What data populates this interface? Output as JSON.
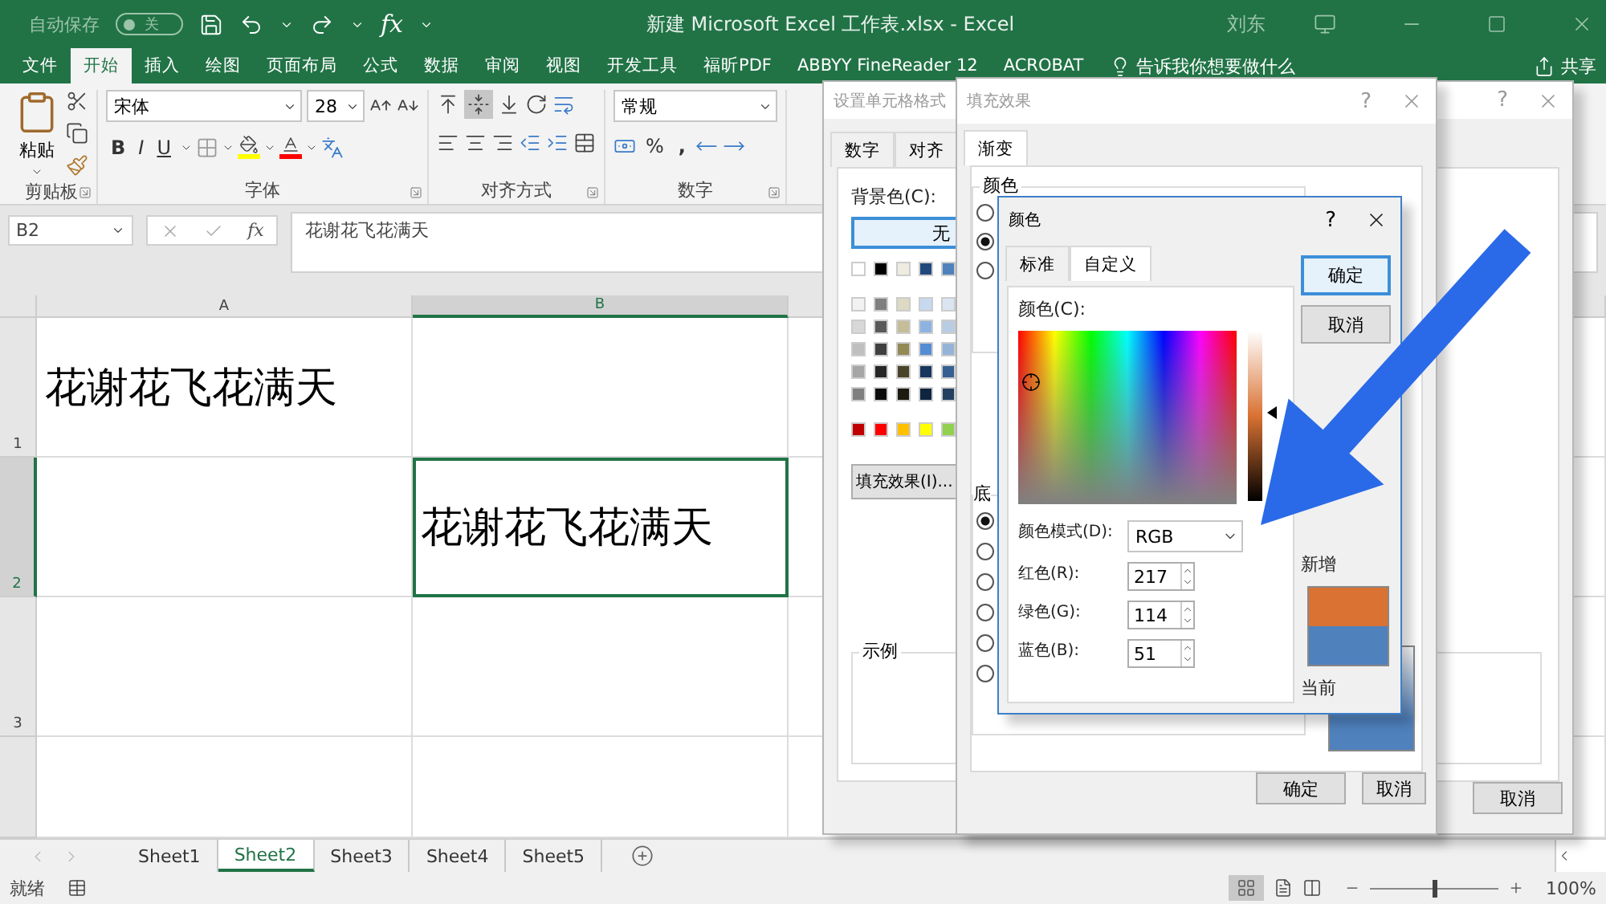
{
  "title_bar": {
    "autosave_label": "自动保存",
    "autosave": {
      "label": "关",
      "on": false
    },
    "insert_function": "fx",
    "title": "新建 Microsoft Excel 工作表.xlsx  -  Excel",
    "user": "刘东"
  },
  "ribbon_tabs": [
    {
      "label": "文件",
      "selected": false
    },
    {
      "label": "开始",
      "selected": true
    },
    {
      "label": "插入",
      "selected": false
    },
    {
      "label": "绘图",
      "selected": false
    },
    {
      "label": "页面布局",
      "selected": false
    },
    {
      "label": "公式",
      "selected": false
    },
    {
      "label": "数据",
      "selected": false
    },
    {
      "label": "审阅",
      "selected": false
    },
    {
      "label": "视图",
      "selected": false
    },
    {
      "label": "开发工具",
      "selected": false
    },
    {
      "label": "福昕PDF",
      "selected": false
    },
    {
      "label": "ABBYY FineReader 12",
      "selected": false
    },
    {
      "label": "ACROBAT",
      "selected": false
    }
  ],
  "tell_me": "告诉我你想要做什么",
  "share": "共享",
  "ribbon": {
    "clipboard": {
      "paste": "粘贴",
      "label": "剪贴板"
    },
    "font": {
      "name": "宋体",
      "size": "28",
      "bold": "B",
      "italic": "I",
      "underline": "U",
      "label": "字体"
    },
    "alignment": {
      "label": "对齐方式"
    },
    "number": {
      "format": "常规",
      "percent": "%",
      "comma": ",",
      "label": "数字"
    }
  },
  "formula_bar": {
    "name_box": "B2",
    "function": "fx",
    "content": "花谢花飞花满天"
  },
  "sheet": {
    "columns": [
      {
        "label": "A",
        "selected": false
      },
      {
        "label": "B",
        "selected": true
      }
    ],
    "rows": [
      {
        "label": "1",
        "selected": false,
        "cells": [
          "花谢花飞花满天",
          ""
        ]
      },
      {
        "label": "2",
        "selected": true,
        "cells": [
          "",
          "花谢花飞花满天"
        ]
      },
      {
        "label": "3",
        "selected": false,
        "cells": [
          "",
          ""
        ]
      }
    ]
  },
  "sheet_tabs": [
    {
      "label": "Sheet1",
      "selected": false
    },
    {
      "label": "Sheet2",
      "selected": true
    },
    {
      "label": "Sheet3",
      "selected": false
    },
    {
      "label": "Sheet4",
      "selected": false
    },
    {
      "label": "Sheet5",
      "selected": false
    }
  ],
  "status_bar": {
    "status": "就绪",
    "zoom": "100%",
    "zoom_slider": {
      "level": 0.5
    }
  },
  "format_cells_dialog": {
    "title": "设置单元格格式",
    "help": "?",
    "tabs": [
      {
        "label": "数字",
        "selected": false
      },
      {
        "label": "对齐",
        "selected": false
      }
    ],
    "background_label": "背景色(C):",
    "no_color_button": "无",
    "palette": [
      [
        {
          "color": "#ffffff"
        },
        {
          "color": "#000000"
        },
        {
          "color": "#eeece1"
        },
        {
          "color": "#1f497d"
        },
        {
          "color": "#4f81bd"
        }
      ],
      [
        {
          "color": "#f2f2f2"
        },
        {
          "color": "#7f7f7f"
        },
        {
          "color": "#ddd9c3"
        },
        {
          "color": "#c6d9f0"
        },
        {
          "color": "#dbe5f1"
        }
      ],
      [
        {
          "color": "#d8d8d8"
        },
        {
          "color": "#595959"
        },
        {
          "color": "#c4bd97"
        },
        {
          "color": "#8db3e2"
        },
        {
          "color": "#b8cce4"
        }
      ],
      [
        {
          "color": "#bfbfbf"
        },
        {
          "color": "#3f3f3f"
        },
        {
          "color": "#938953"
        },
        {
          "color": "#548dd4"
        },
        {
          "color": "#95b3d7"
        }
      ],
      [
        {
          "color": "#a5a5a5"
        },
        {
          "color": "#262626"
        },
        {
          "color": "#494429"
        },
        {
          "color": "#17365d"
        },
        {
          "color": "#366092"
        }
      ],
      [
        {
          "color": "#7f7f7f"
        },
        {
          "color": "#0c0c0c"
        },
        {
          "color": "#1d1b10"
        },
        {
          "color": "#0f243e"
        },
        {
          "color": "#244061"
        }
      ],
      [
        {
          "color": "#c00000"
        },
        {
          "color": "#ff0000"
        },
        {
          "color": "#ffc000"
        },
        {
          "color": "#ffff00"
        },
        {
          "color": "#92d050"
        }
      ]
    ],
    "fill_effects_button": "填充效果(I)...",
    "sample_label": "示例",
    "cancel_button": "取消"
  },
  "fill_effects_dialog": {
    "title": "填充效果",
    "help": "?",
    "tabs": [
      {
        "label": "渐变",
        "selected": true
      }
    ],
    "colors_label": "颜色",
    "color_options": [
      {
        "selected": false
      },
      {
        "selected": true
      },
      {
        "selected": false
      }
    ],
    "shading_label": "底",
    "shading_options": [
      {
        "selected": true
      },
      {
        "selected": false
      },
      {
        "selected": false
      },
      {
        "selected": false
      },
      {
        "selected": false
      },
      {
        "selected": false
      }
    ],
    "ok_button": "确定",
    "cancel_button": "取消"
  },
  "color_dialog": {
    "title": "颜色",
    "help": "?",
    "tabs": [
      {
        "label": "标准",
        "selected": false
      },
      {
        "label": "自定义",
        "selected": true
      }
    ],
    "spectrum_label": "颜色(C):",
    "luminance": {
      "level": 0.52
    },
    "mode_label": "颜色模式(D):",
    "mode": "RGB",
    "channels": [
      {
        "label": "红色(R):",
        "value": "217"
      },
      {
        "label": "绿色(G):",
        "value": "114"
      },
      {
        "label": "蓝色(B):",
        "value": "51"
      }
    ],
    "ok_button": "确定",
    "cancel_button": "取消",
    "swatches": [
      {
        "label": "新增",
        "color": "#d97233"
      },
      {
        "label": "当前",
        "color": "#4f81bd"
      }
    ]
  }
}
